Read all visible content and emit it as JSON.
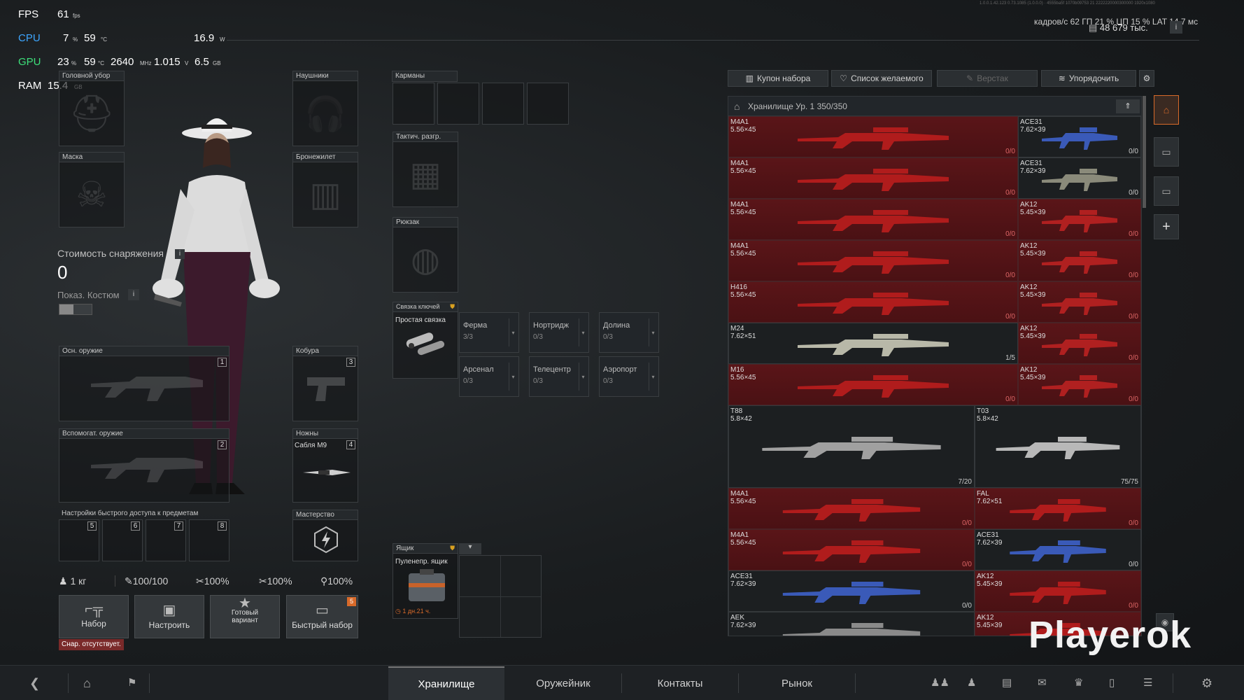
{
  "hud": {
    "fps_label": "FPS",
    "fps_value": "61",
    "fps_unit": "fps",
    "cpu_label": "CPU",
    "cpu_load": "7",
    "cpu_load_unit": "%",
    "cpu_temp": "59",
    "cpu_temp_unit": "°C",
    "cpu_power": "16.9",
    "cpu_power_unit": "W",
    "gpu_label": "GPU",
    "gpu_load": "23",
    "gpu_load_unit": "%",
    "gpu_temp": "59",
    "gpu_temp_unit": "°C",
    "gpu_clock": "2640",
    "gpu_clock_unit": "MHz",
    "gpu_volt": "1.015",
    "gpu_volt_unit": "V",
    "gpu_mem": "6.5",
    "gpu_mem_unit": "GB",
    "ram_label": "RAM",
    "ram_value": "15.4",
    "ram_unit": "GB",
    "build_info": "1.0.0.1.42.123 0.73.1085 (1.0.0.0) · 4555ba5f 1070b09753 21 2222220000300000 1920x1080",
    "right_overlay": "кадров/с  62  ГП 21 % ЦП 15 % LAT 14.7 мс",
    "currency": "48 679 тыс."
  },
  "gear": {
    "headwear": "Головной убор",
    "headphones": "Наушники",
    "mask": "Маска",
    "armor": "Бронежилет",
    "gear_value_label": "Стоимость снаряжения",
    "gear_value": "0",
    "show_costume": "Показ. Костюм",
    "primary": "Осн. оружие",
    "primary_idx": "1",
    "secondary": "Вспомогат. оружие",
    "secondary_idx": "2",
    "holster": "Кобура",
    "holster_idx": "3",
    "knives": "Ножны",
    "knife_name": "Сабля M9",
    "knife_idx": "4",
    "quick_access": "Настройки быстрого доступа к предметам",
    "quick_slots": [
      "5",
      "6",
      "7",
      "8"
    ],
    "mastery": "Мастерство"
  },
  "containers": {
    "pockets": "Карманы",
    "tactical_rig": "Тактич. разгр.",
    "backpack": "Рюкзак",
    "keyring_label": "Связка ключей",
    "keyring_item": "Простая связка",
    "quests": [
      {
        "name": "Ферма",
        "progress": "3/3"
      },
      {
        "name": "Нортридж",
        "progress": "0/3"
      },
      {
        "name": "Долина",
        "progress": "0/3"
      },
      {
        "name": "Арсенал",
        "progress": "0/3"
      },
      {
        "name": "Телецентр",
        "progress": "0/3"
      },
      {
        "name": "Аэропорт",
        "progress": "0/3"
      }
    ],
    "box_label": "Ящик",
    "box_item": "Пуленепр. ящик",
    "box_timer": "1 дн.21 ч."
  },
  "stats": {
    "weight": "1 кг",
    "stat1": "100/100",
    "stat2": "100%",
    "stat3": "100%",
    "stat4": "100%"
  },
  "actions": {
    "kit": "Набор",
    "configure": "Настроить",
    "preset_line1": "Готовый",
    "preset_line2": "вариант",
    "quick_kit": "Быстрый набор",
    "quick_kit_badge": "5",
    "missing_note": "Снар. отсутствует."
  },
  "stash": {
    "coupon": "Купон набора",
    "wishlist": "Список желаемого",
    "workbench": "Верстак",
    "sort": "Упорядочить",
    "title": "Хранилище Ур. 1 350/350",
    "rows": [
      {
        "left": {
          "name": "M4A1",
          "cal": "5.56×45",
          "count": "0/0"
        },
        "right": {
          "name": "ACE31",
          "cal": "7.62×39",
          "count": "0/0"
        }
      },
      {
        "left": {
          "name": "M4A1",
          "cal": "5.56×45",
          "count": "0/0"
        },
        "right": {
          "name": "ACE31",
          "cal": "7.62×39",
          "count": "0/0"
        }
      },
      {
        "left": {
          "name": "M4A1",
          "cal": "5.56×45",
          "count": "0/0"
        },
        "right": {
          "name": "AK12",
          "cal": "5.45×39",
          "count": "0/0"
        }
      },
      {
        "left": {
          "name": "M4A1",
          "cal": "5.56×45",
          "count": "0/0"
        },
        "right": {
          "name": "AK12",
          "cal": "5.45×39",
          "count": "0/0"
        }
      },
      {
        "left": {
          "name": "H416",
          "cal": "5.56×45",
          "count": "0/0"
        },
        "right": {
          "name": "AK12",
          "cal": "5.45×39",
          "count": "0/0"
        }
      },
      {
        "left": {
          "name": "M24",
          "cal": "7.62×51",
          "count": "1/5"
        },
        "right": {
          "name": "AK12",
          "cal": "5.45×39",
          "count": "0/0"
        }
      },
      {
        "left": {
          "name": "M16",
          "cal": "5.56×45",
          "count": "0/0"
        },
        "right": {
          "name": "AK12",
          "cal": "5.45×39",
          "count": "0/0"
        }
      }
    ],
    "big": [
      {
        "name": "T88",
        "cal": "5.8×42",
        "count": "7/20"
      },
      {
        "name": "T03",
        "cal": "5.8×42",
        "count": "75/75"
      }
    ],
    "rows2": [
      {
        "left": {
          "name": "M4A1",
          "cal": "5.56×45",
          "count": "0/0"
        },
        "right": {
          "name": "FAL",
          "cal": "7.62×51",
          "count": "0/0"
        }
      },
      {
        "left": {
          "name": "M4A1",
          "cal": "5.56×45",
          "count": "0/0"
        },
        "right": {
          "name": "ACE31",
          "cal": "7.62×39",
          "count": "0/0"
        }
      },
      {
        "left": {
          "name": "ACE31",
          "cal": "7.62×39",
          "count": "0/0"
        },
        "right": {
          "name": "AK12",
          "cal": "5.45×39",
          "count": "0/0"
        }
      },
      {
        "left": {
          "name": "AEK",
          "cal": "7.62×39",
          "count": ""
        },
        "right": {
          "name": "AK12",
          "cal": "5.45×39",
          "count": ""
        }
      }
    ]
  },
  "nav": {
    "tabs": [
      "Хранилище",
      "Оружейник",
      "Контакты",
      "Рынок"
    ]
  },
  "watermark": "Playerok",
  "colors": {
    "accent": "#d86a2a",
    "item_red": "#5a1518",
    "fps": "#ffffff",
    "cpu": "#3da6ff",
    "gpu": "#3de07a"
  }
}
